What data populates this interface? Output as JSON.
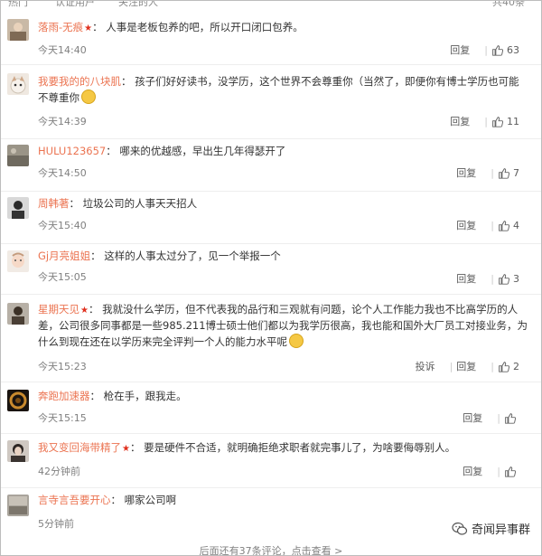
{
  "header": {
    "partial_tabs": [
      "热门",
      "认证用户",
      "关注的人"
    ],
    "partial_count": "共40条"
  },
  "comments": [
    {
      "name": "落雨-无痕",
      "badge": "★",
      "text": "人事是老板包养的吧，所以开口闭口包养。",
      "time": "今天14:40",
      "reply": "回复",
      "report": "",
      "likes": "63"
    },
    {
      "name": "我要我的的八块肌",
      "badge": "",
      "text": "孩子们好好读书，没学历，这个世界不会尊重你（当然了，即便你有博士学历也可能不尊重你",
      "time": "今天14:39",
      "reply": "回复",
      "report": "",
      "likes": "11"
    },
    {
      "name": "HULU123657",
      "badge": "",
      "text": "哪来的优越感，早出生几年得瑟开了",
      "time": "今天14:50",
      "reply": "回复",
      "report": "",
      "likes": "7"
    },
    {
      "name": "周韩著",
      "badge": "",
      "text": "垃圾公司的人事天天招人",
      "time": "今天15:40",
      "reply": "回复",
      "report": "",
      "likes": "4"
    },
    {
      "name": "Gj月亮姐姐",
      "badge": "",
      "text": "这样的人事太过分了，见一个举报一个",
      "time": "今天15:05",
      "reply": "回复",
      "report": "",
      "likes": "3"
    },
    {
      "name": "星期天见",
      "badge": "★",
      "text": "我就没什么学历，但不代表我的品行和三观就有问题，论个人工作能力我也不比高学历的人差，公司很多同事都是一些985.211博士硕士他们都以为我学历很高，我也能和国外大厂员工对接业务，为什么到现在还在以学历来完全评判一个人的能力水平呢",
      "time": "今天15:23",
      "reply": "回复",
      "report": "投诉",
      "likes": "2"
    },
    {
      "name": "奔跑加速器",
      "badge": "",
      "text": "枪在手，跟我走。",
      "time": "今天15:15",
      "reply": "回复",
      "report": "",
      "likes": ""
    },
    {
      "name": "我又变回海带精了",
      "badge": "★",
      "text": "要是硬件不合适，就明确拒绝求职者就完事儿了，为啥要侮辱别人。",
      "time": "42分钟前",
      "reply": "回复",
      "report": "",
      "likes": ""
    },
    {
      "name": "言寺言吾要开心",
      "badge": "",
      "text": "哪家公司啊",
      "time": "5分钟前",
      "reply": "回复",
      "report": "",
      "likes": ""
    }
  ],
  "footer": {
    "more_text": "后面还有37条评论，点击查看 >"
  },
  "watermark": {
    "text": "奇闻异事群"
  },
  "colors": {
    "name": "#eb7350",
    "badge": "#e0301e",
    "meta": "#808080"
  }
}
